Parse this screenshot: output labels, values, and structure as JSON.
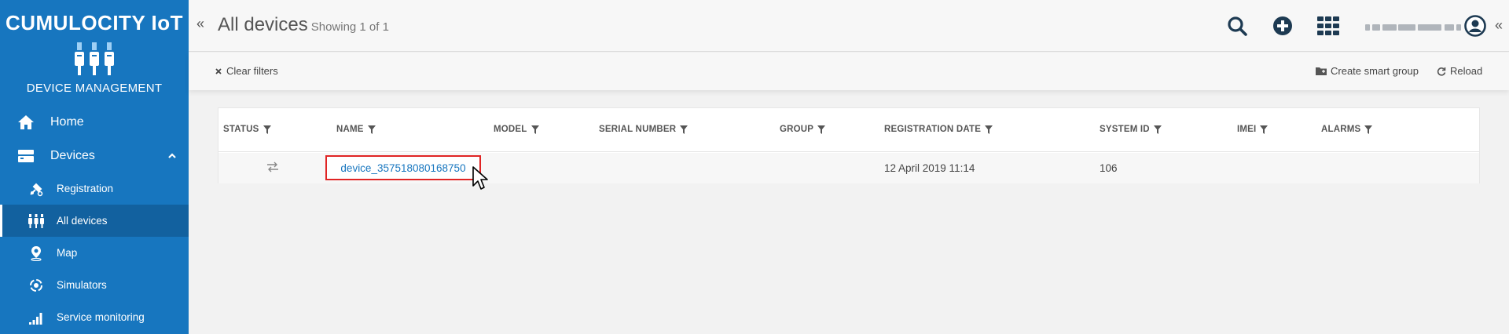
{
  "brand": {
    "name": "CUMULOCITY IoT",
    "app_name": "DEVICE MANAGEMENT",
    "accent": "#1776bf"
  },
  "sidebar": {
    "items": [
      {
        "label": "Home",
        "icon": "home-icon"
      },
      {
        "label": "Devices",
        "icon": "devices-icon",
        "expanded": true,
        "children": [
          {
            "label": "Registration",
            "icon": "registration-icon"
          },
          {
            "label": "All devices",
            "icon": "all-devices-icon",
            "active": true
          },
          {
            "label": "Map",
            "icon": "map-pin-icon"
          },
          {
            "label": "Simulators",
            "icon": "simulator-icon"
          },
          {
            "label": "Service monitoring",
            "icon": "signal-icon"
          }
        ]
      }
    ]
  },
  "header": {
    "collapse_left": "«",
    "title": "All devices",
    "subtitle": "Showing 1 of 1",
    "collapse_right": "«",
    "icons": [
      "search-icon",
      "add-icon",
      "app-switcher-icon",
      "user-icon"
    ]
  },
  "actionbar": {
    "clear_filters": "Clear filters",
    "create_smart_group": "Create smart group",
    "reload": "Reload"
  },
  "table": {
    "columns": [
      "STATUS",
      "NAME",
      "MODEL",
      "SERIAL NUMBER",
      "GROUP",
      "REGISTRATION DATE",
      "SYSTEM ID",
      "IMEI",
      "ALARMS"
    ],
    "rows": [
      {
        "status": "connection-arrows-icon",
        "name": "device_357518080168750",
        "model": "",
        "serial_number": "",
        "group": "",
        "registration_date": "12 April 2019 11:14",
        "system_id": "106",
        "imei": "",
        "alarms": ""
      }
    ]
  }
}
